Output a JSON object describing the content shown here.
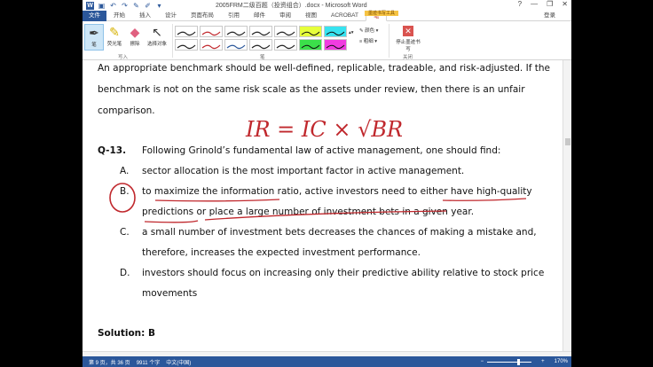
{
  "window": {
    "title": "2005FRM二级百题（投资组合）.docx - Microsoft Word",
    "minimize": "—",
    "restore": "❐",
    "close": "✕",
    "help": "?"
  },
  "ribbon_tabs": {
    "file": "文件",
    "home": "开始",
    "insert": "插入",
    "design": "设计",
    "layout": "页面布局",
    "references": "引用",
    "mailings": "邮件",
    "review": "审阅",
    "view": "视图",
    "acrobat": "ACROBAT",
    "pen": "笔",
    "context": "墨迹书写工具",
    "login": "登录"
  },
  "ribbon": {
    "pen_label": "笔",
    "highlighter_label": "荧光笔",
    "eraser_label": "擦除",
    "select_label": "选择对象",
    "write_group": "写入",
    "pens_group": "笔",
    "color_label": "颜色",
    "thickness_label": "粗细",
    "stop_label": "停止墨迹书写",
    "close_group": "关闭"
  },
  "document": {
    "line1": "An appropriate benchmark should be well-defined, replicable, tradeable, and risk-adjusted. If the",
    "line2": "benchmark is not on the same risk scale as the assets under review, then there is an unfair",
    "line3": "comparison.",
    "question_num": "Q-13.",
    "question_text": "Following Grinold’s fundamental law of active management, one should find:",
    "a_label": "A.",
    "a_text": "sector allocation is the most important factor in active management.",
    "b_label": "B.",
    "b_text1": "to maximize the information ratio, active investors need to either have high-quality",
    "b_text2": "predictions or place a large number of investment bets in a given year.",
    "c_label": "C.",
    "c_text1": "a small number of investment bets decreases the chances of making a mistake and,",
    "c_text2": "therefore, increases the expected investment performance.",
    "d_label": "D.",
    "d_text1": "investors should focus on increasing only their predictive ability relative to stock price",
    "d_text2": "movements",
    "solution": "Solution: B",
    "ink_formula": "IR = IC × √BR"
  },
  "status": {
    "page": "第 9 页，共 36 页",
    "words": "9911 个字",
    "lang": "中文(中国)",
    "zoom": "170%",
    "zoom_minus": "−",
    "zoom_plus": "+"
  },
  "colors": {
    "word_blue": "#2b579a",
    "ink_red": "#c0282d",
    "context_tab": "#f6c343"
  }
}
